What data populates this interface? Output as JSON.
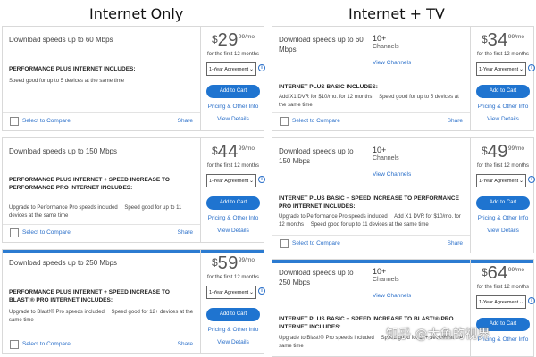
{
  "columns": {
    "left_title": "Internet Only",
    "right_title": "Internet + TV"
  },
  "common": {
    "currency": "$",
    "cents_mo": "99/mo",
    "first12": "for the first 12 months",
    "agreement": "1-Year Agreement",
    "add_to_cart": "Add to Cart",
    "pricing": "Pricing & Other Info",
    "view_details": "View Details",
    "select_compare": "Select to Compare",
    "share": "Share",
    "channels_num": "10+",
    "channels_label": "Channels",
    "view_channels": "View Channels",
    "info_glyph": "i",
    "chevron": "⌄"
  },
  "internet_only": [
    {
      "download": "Download speeds up to 60 Mbps",
      "price": "29",
      "includes": "PERFORMANCE PLUS INTERNET INCLUDES:",
      "bullets": [
        "Speed good for up to 5 devices at the same time"
      ]
    },
    {
      "download": "Download speeds up to 150 Mbps",
      "price": "44",
      "includes": "PERFORMANCE PLUS INTERNET + SPEED INCREASE TO PERFORMANCE PRO INTERNET INCLUDES:",
      "bullets": [
        "Upgrade to Performance Pro speeds included",
        "Speed good for up to 11 devices at the same time"
      ]
    },
    {
      "download": "Download speeds up to 250 Mbps",
      "price": "59",
      "includes": "PERFORMANCE PLUS INTERNET + SPEED INCREASE TO BLAST!® PRO INTERNET INCLUDES:",
      "bullets": [
        "Upgrade to Blast!® Pro speeds included",
        "Speed good for 12+ devices at the same time"
      ]
    }
  ],
  "internet_tv": [
    {
      "download": "Download speeds up to 60 Mbps",
      "price": "34",
      "includes": "INTERNET PLUS BASIC INCLUDES:",
      "bullets": [
        "Add X1 DVR for $10/mo. for 12 months",
        "Speed good for up to 5 devices at the same time"
      ]
    },
    {
      "download": "Download speeds up to 150 Mbps",
      "price": "49",
      "includes": "INTERNET PLUS BASIC + SPEED INCREASE TO PERFORMANCE PRO INTERNET INCLUDES:",
      "bullets": [
        "Upgrade to Performance Pro speeds included",
        "Add X1 DVR for $10/mo. for 12 months",
        "Speed good for up to 11 devices at the same time"
      ]
    },
    {
      "download": "Download speeds up to 250 Mbps",
      "price": "64",
      "includes": "INTERNET PLUS BASIC + SPEED INCREASE TO BLAST!® PRO INTERNET INCLUDES:",
      "bullets": [
        "Upgrade to Blast!® Pro speeds included",
        "Speed good for 12+ devices at the same time"
      ]
    }
  ],
  "watermark": "知乎 @大鱼的视界",
  "colors": {
    "accent": "#1f74d0",
    "link": "#2a6fc9",
    "border": "#d9d9d9",
    "topbar": "#2b7bd1"
  }
}
